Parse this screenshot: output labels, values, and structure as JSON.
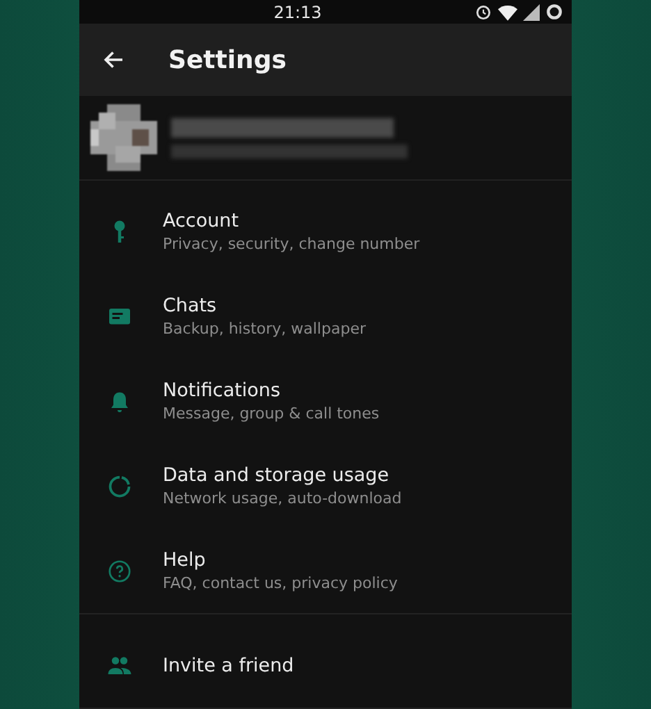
{
  "status_bar": {
    "time": "21:13"
  },
  "toolbar": {
    "title": "Settings"
  },
  "sections": [
    [
      {
        "kind": "key",
        "title": "Account",
        "subtitle": "Privacy, security, change number"
      },
      {
        "kind": "chat",
        "title": "Chats",
        "subtitle": "Backup, history, wallpaper"
      },
      {
        "kind": "bell",
        "title": "Notifications",
        "subtitle": "Message, group & call tones"
      },
      {
        "kind": "data",
        "title": "Data and storage usage",
        "subtitle": "Network usage, auto-download"
      },
      {
        "kind": "help",
        "title": "Help",
        "subtitle": "FAQ, contact us, privacy policy"
      }
    ],
    [
      {
        "kind": "people",
        "title": "Invite a friend"
      }
    ]
  ]
}
